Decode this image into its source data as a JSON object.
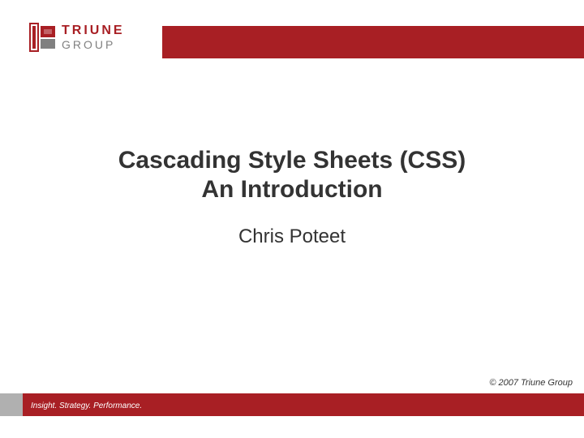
{
  "logo": {
    "top_text": "TRIUNE",
    "bottom_text": "GROUP"
  },
  "title": {
    "line1": "Cascading Style Sheets (CSS)",
    "line2": "An Introduction"
  },
  "subtitle": "Chris Poteet",
  "copyright": "© 2007 Triune Group",
  "tagline": "Insight. Strategy. Performance.",
  "colors": {
    "brand_red": "#a81f24",
    "gray": "#808080"
  }
}
